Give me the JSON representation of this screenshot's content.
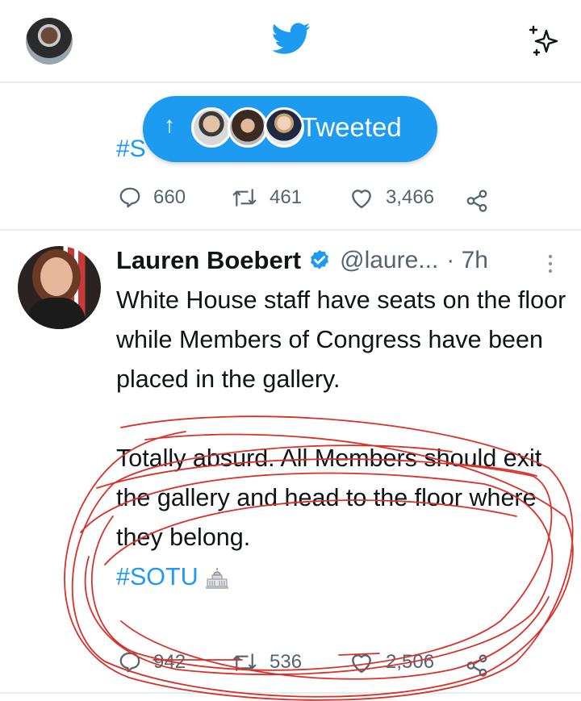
{
  "topbar": {
    "logo": "twitter-bird-icon",
    "sparkle": "sparkle-icon"
  },
  "pill": {
    "label": "Tweeted",
    "arrow": "↑"
  },
  "prev_tweet": {
    "hashtag": "#S",
    "replies": "660",
    "retweets": "461",
    "likes": "3,466"
  },
  "tweet": {
    "name": "Lauren Boebert",
    "handle": "@laure...",
    "time": "· 7h",
    "paragraph1": "White House staff have seats on the floor while Members of Congress have been placed in the gallery.",
    "paragraph2": "Totally absurd. All Members should exit the gallery and head to the floor where they belong.",
    "hashtag": "#SOTU",
    "replies": "942",
    "retweets": "536",
    "likes": "2,506"
  },
  "colors": {
    "accent": "#1d9bf0",
    "annotation": "#d8312a",
    "muted": "#536471"
  }
}
